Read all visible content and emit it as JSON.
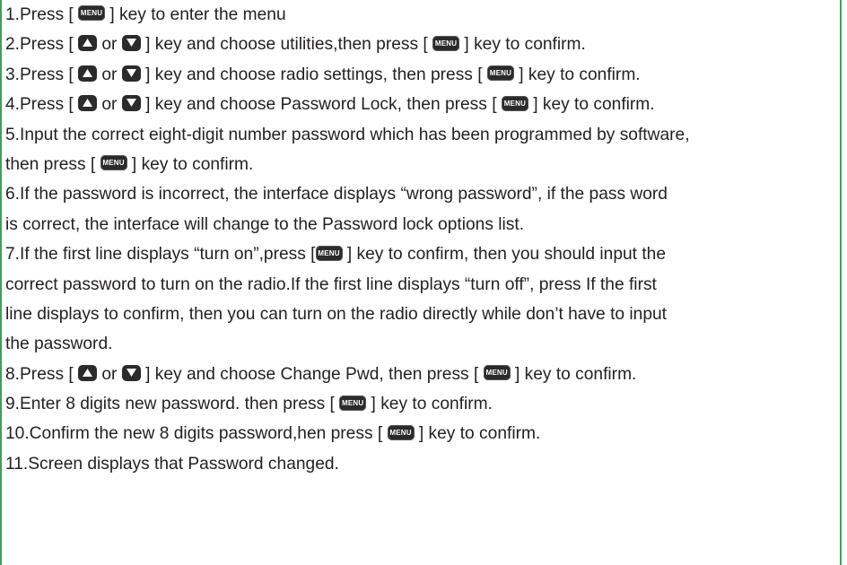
{
  "keys": {
    "menu": "MENU",
    "up_icon": "up-triangle-icon",
    "down_icon": "down-triangle-icon"
  },
  "colors": {
    "border": "#3aa35a",
    "text": "#231f20",
    "key_fill": "#2b2b2b"
  },
  "lines": [
    {
      "a": "1.Press [ ",
      "b": " ] key to enter the menu"
    },
    {
      "a": "2.Press [ ",
      "b": " or ",
      "c": " ] key and choose utilities,then press [ ",
      "d": " ] key to confirm."
    },
    {
      "a": "3.Press [ ",
      "b": " or ",
      "c": " ] key and choose radio settings, then press [ ",
      "d": " ] key to confirm."
    },
    {
      "a": "4.Press [ ",
      "b": " or ",
      "c": " ] key and choose Password Lock, then press [ ",
      "d": " ] key to confirm."
    },
    {
      "a": "5.Input the correct eight-digit number password which has been programmed by software,"
    },
    {
      "a": "then press [ ",
      "b": " ] key to confirm."
    },
    {
      "a": "6.If the password is incorrect, the interface displays “wrong password”, if the pass word"
    },
    {
      "a": "is correct, the interface will change to the Password lock options list."
    },
    {
      "a": "7.If the first line displays “turn on”,press [",
      "b": " ] key to confirm, then you should input the"
    },
    {
      "a": "correct password to turn on the radio.If the first line displays “turn off”, press If the first"
    },
    {
      "a": "line displays to confirm, then you can turn on the radio directly while don’t have to input"
    },
    {
      "a": "the password."
    },
    {
      "a": "8.Press [ ",
      "b": " or ",
      "c": " ] key and choose Change Pwd, then press [ ",
      "d": " ] key to confirm."
    },
    {
      "a": "9.Enter 8 digits new password. then press [ ",
      "b": " ] key to confirm."
    },
    {
      "a": "10.Confirm the new 8 digits password,hen press [ ",
      "b": " ] key to confirm."
    },
    {
      "a": "11.Screen displays that Password changed."
    }
  ]
}
